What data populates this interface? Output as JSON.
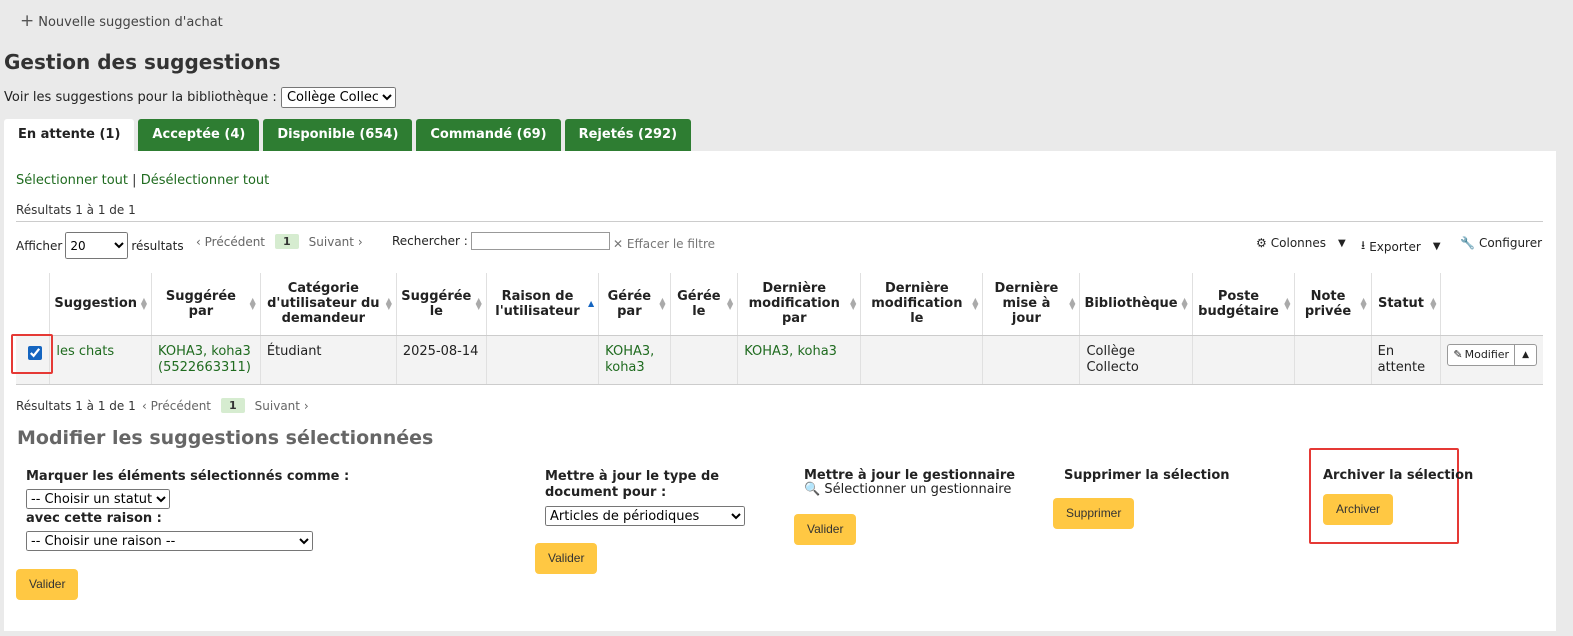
{
  "top": {
    "new_suggestion": "Nouvelle suggestion d'achat"
  },
  "title": "Gestion des suggestions",
  "library": {
    "label": "Voir les suggestions pour la bibliothèque :",
    "selected": "Collège Collecto"
  },
  "tabs": [
    {
      "label": "En attente (1)"
    },
    {
      "label": "Acceptée (4)"
    },
    {
      "label": "Disponible (654)"
    },
    {
      "label": "Commandé (69)"
    },
    {
      "label": "Rejetés (292)"
    }
  ],
  "select_all": "Sélectionner tout",
  "separator": "|",
  "deselect_all": "Désélectionner tout",
  "results_info": "Résultats 1 à 1 de 1",
  "toolbar": {
    "show": "Afficher",
    "page_length": "20",
    "results_word": "résultats",
    "prev": "Précédent",
    "page": "1",
    "next": "Suivant",
    "search_label": "Rechercher :",
    "clear_filter": "Effacer le filtre",
    "columns": "Colonnes",
    "export": "Exporter",
    "configure": "Configurer"
  },
  "table": {
    "headers": [
      "Suggestion",
      "Suggérée par",
      "Catégorie d'utilisateur du demandeur",
      "Suggérée le",
      "Raison de l'utilisateur",
      "Gérée par",
      "Gérée le",
      "Dernière modification par",
      "Dernière modification le",
      "Dernière mise à jour",
      "Bibliothèque",
      "Poste budgétaire",
      "Note privée",
      "Statut"
    ],
    "row": {
      "suggestion": "les chats",
      "suggested_by": "KOHA3, koha3 (5522663311)",
      "category": "Étudiant",
      "suggested_on": "2025-08-14",
      "reason": "",
      "managed_by": "KOHA3, koha3",
      "managed_on": "",
      "last_modif_by": "KOHA3, koha3",
      "last_modif_on": "",
      "last_update": "",
      "library": "Collège Collecto",
      "budget": "",
      "note": "",
      "status": "En attente",
      "edit_label": "Modifier"
    }
  },
  "bottom_results": "Résultats 1 à 1 de 1",
  "modify": {
    "title": "Modifier les suggestions sélectionnées",
    "mark_label": "Marquer les éléments sélectionnés comme :",
    "status_placeholder": "-- Choisir un statut --",
    "reason_label": "avec cette raison :",
    "reason_placeholder": "-- Choisir une raison --",
    "validate": "Valider",
    "doc_type_label": "Mettre à jour le type de document pour :",
    "doc_type_selected": "Articles de périodiques",
    "manager_label": "Mettre à jour le gestionnaire",
    "choose_manager": "Sélectionner un gestionnaire",
    "delete_label": "Supprimer la sélection",
    "delete_button": "Supprimer",
    "archive_label": "Archiver la sélection",
    "archive_button": "Archiver"
  }
}
